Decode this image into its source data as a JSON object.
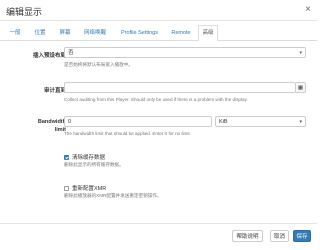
{
  "dialog": {
    "title": "编辑显示",
    "close_glyph": "×"
  },
  "tabs": [
    {
      "label": "一般"
    },
    {
      "label": "位置"
    },
    {
      "label": "屏幕"
    },
    {
      "label": "网络唤醒"
    },
    {
      "label": "Profile Settings"
    },
    {
      "label": "Remote"
    },
    {
      "label": "高级",
      "active": true
    }
  ],
  "fields": {
    "embed_player": {
      "label": "插入预设布局",
      "value": "否",
      "help": "是否始终将默认布局嵌入播放中。"
    },
    "audit_until": {
      "label": "审计直到",
      "value": "",
      "help": "Collect auditing from this Player. Should only be used if there is a problem with the display."
    },
    "bandwidth": {
      "label_line1": "Bandwidth",
      "label_line2": "limit",
      "value": "0",
      "unit": "KiB",
      "help": "The bandwidth limit that should be applied. Enter 0 for no limit."
    },
    "clear_cache": {
      "label": "清除缓存数据",
      "checked": true,
      "help": "删除此显示的所有缓存数据。"
    },
    "reconfigure_xmr": {
      "label": "重新配置XMR",
      "checked": false,
      "help": "删除此播放器的XMR配置并发送重定密钥操作。"
    }
  },
  "footer": {
    "help_label": "帮助说明",
    "cancel_label": "取消",
    "save_label": "保存"
  },
  "colors": {
    "primary": "#337ab7",
    "link": "#337ab7"
  },
  "icons": {
    "calendar": "calendar-icon",
    "close": "close-icon",
    "dropdown": "chevron-down-icon"
  }
}
